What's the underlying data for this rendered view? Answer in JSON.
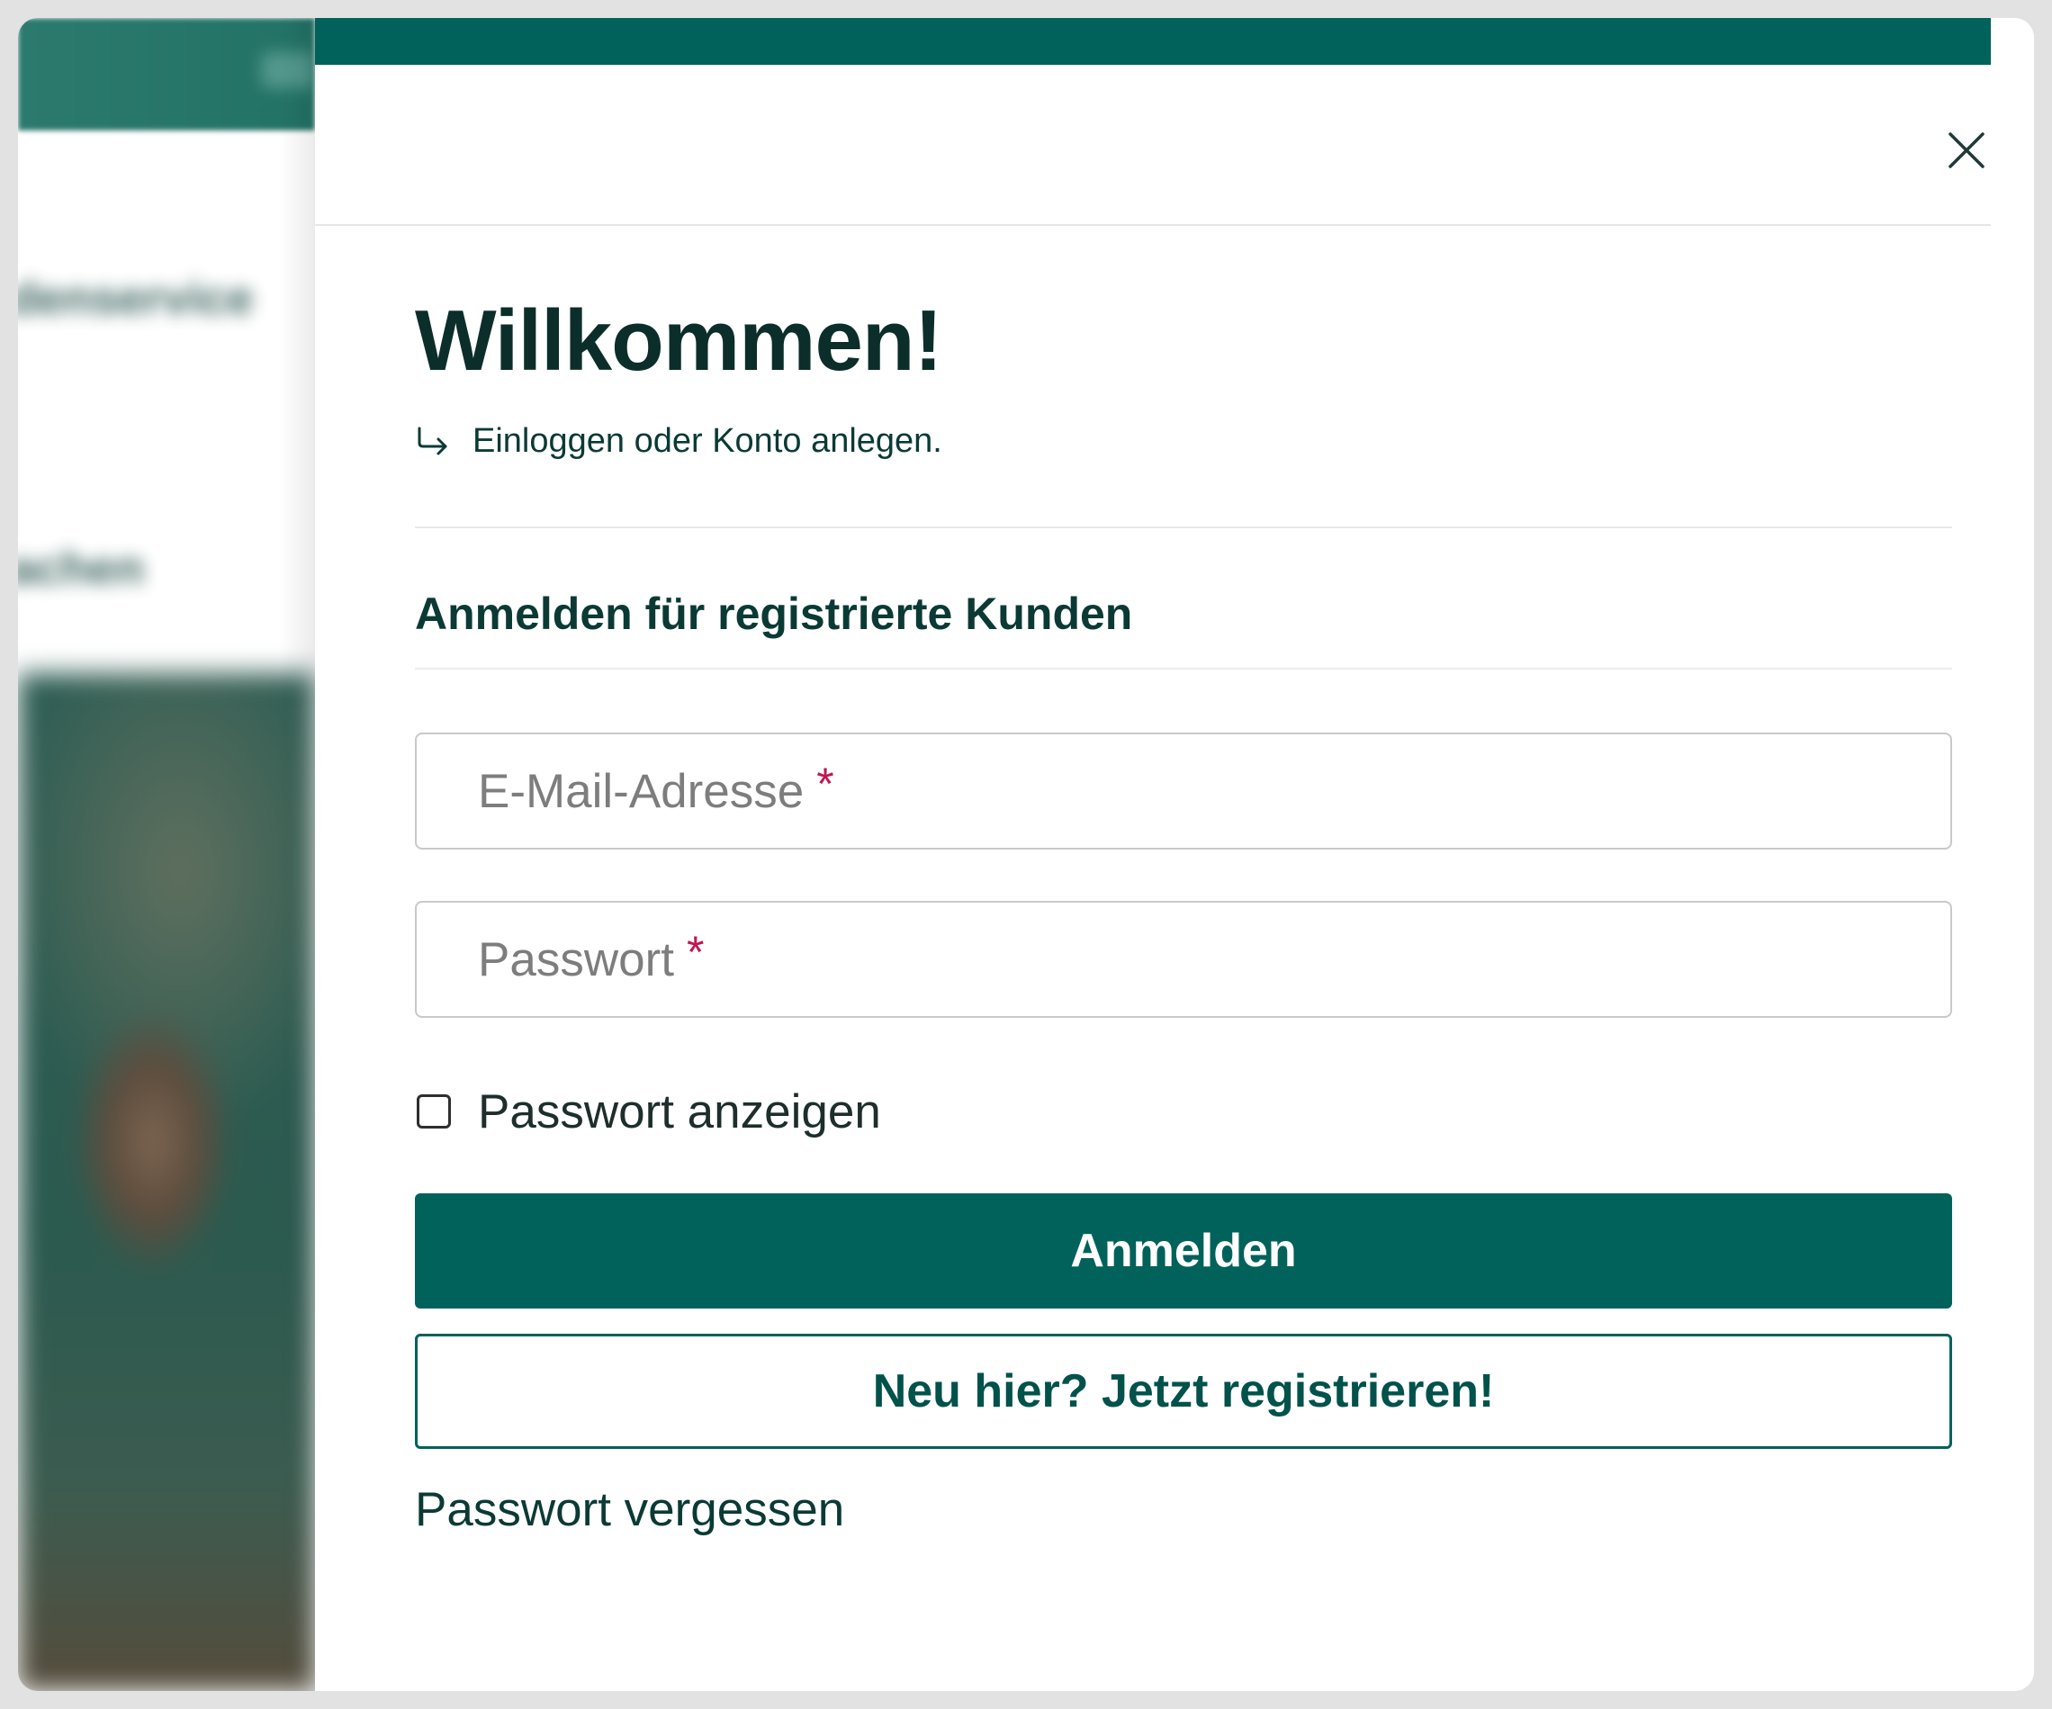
{
  "background_page": {
    "blurred_texts": [
      "denservice",
      "achen"
    ]
  },
  "modal": {
    "close_icon": "close-icon",
    "title": "Willkommen!",
    "subtitle": {
      "icon": "arrow-return-right-icon",
      "text": "Einloggen oder Konto anlegen."
    },
    "section_title": "Anmelden für registrierte Kunden",
    "email_field": {
      "label": "E-Mail-Adresse",
      "required_marker": "*",
      "value": ""
    },
    "password_field": {
      "label": "Passwort",
      "required_marker": "*",
      "value": ""
    },
    "show_password": {
      "label": "Passwort anzeigen",
      "checked": false
    },
    "login_button": "Anmelden",
    "register_button": "Neu hier? Jetzt registrieren!",
    "forgot_password_link": "Passwort vergessen"
  },
  "colors": {
    "brand_green": "#00625a",
    "heading_dark": "#0b2e2a",
    "required_red": "#c0174f",
    "field_border": "#c9c9c9"
  }
}
